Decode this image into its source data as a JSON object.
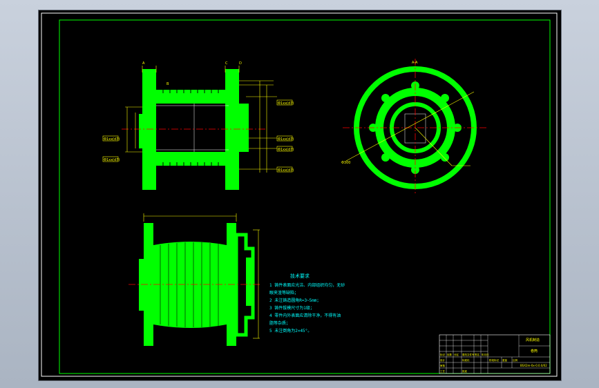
{
  "drawing": {
    "tech_title": "技术要求",
    "tech_lines": [
      "1 铸件表面应光洁、内部组织均匀，无砂",
      "  眼夹渣等缺陷；",
      "2 未注铸造圆角R=3~5mm；",
      "3 铸件拔模尺寸为1级；",
      "4 零件内外表面应清除干净，不得有油",
      "  脂等杂质；",
      "5 未注倒角为2×45°。"
    ],
    "title_block": {
      "company": "风机制造",
      "part_name": "卷筒",
      "drawing_no": "BSX2m-0x-0.0.0/02",
      "row_labels": [
        "标记",
        "处数",
        "分区",
        "更改文件号",
        "签名",
        "年月日"
      ],
      "sign_labels": [
        "设计",
        "标准化",
        "审核",
        "工艺",
        "批准"
      ],
      "stage_labels": [
        "阶段标记",
        "重量",
        "比例"
      ]
    },
    "callouts": {
      "left": [
        "Φ1xx(d7)",
        "Φ1xx(d7)",
        "Φ1xx(d7)"
      ],
      "right": [
        "Φ1xx(d7)",
        "Φ1xx(d7)",
        "Φ1xx(d7)",
        "Φ1xx(d7)"
      ],
      "top_left": [
        "A",
        "B",
        "C",
        "D"
      ],
      "section_label": "A-A",
      "dia_label": "Φ300"
    },
    "colors": {
      "outline": "#00ff00",
      "dimension": "#ffff00",
      "centerline": "#ff0000",
      "text": "#00ffff",
      "frame": "#ffffff"
    }
  }
}
